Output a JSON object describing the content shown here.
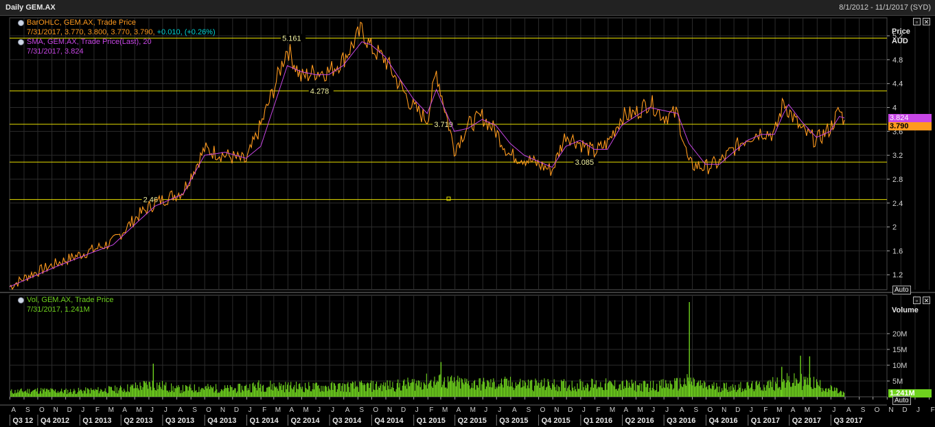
{
  "window": {
    "title": "Daily GEM.AX",
    "date_range": "8/1/2012 - 11/1/2017 (SYD)"
  },
  "price_panel": {
    "legend": {
      "ohlc_label": "BarOHLC, GEM.AX, Trade Price",
      "ohlc_values": "7/31/2017, 3.770, 3.800, 3.770, 3.790,",
      "ohlc_change": "+0.010, (+0.26%)",
      "sma_label": "SMA, GEM.AX, Trade Price(Last),  20",
      "sma_values": "7/31/2017, 3.824"
    },
    "axis_title": "Price",
    "axis_unit": "AUD",
    "auto_label": "Auto",
    "last_sma_badge": "3.824",
    "last_price_badge": "3.790"
  },
  "volume_panel": {
    "legend": {
      "label": "Vol, GEM.AX, Trade Price",
      "values": "7/31/2017, 1.241M"
    },
    "axis_title": "Volume",
    "auto_label": "Auto",
    "last_badge": "1.241M"
  },
  "colors": {
    "price": "#ff9a1e",
    "sma": "#c846e6",
    "level": "#e8e000",
    "volume": "#6fd21e",
    "change": "#00d4d4",
    "grid": "#2c2c2c"
  },
  "chart_data": [
    {
      "type": "line",
      "title": "",
      "ylabel": "Price AUD",
      "ylim": [
        0.95,
        5.5
      ],
      "grid": true,
      "y_ticks": [
        "1.2",
        "1.6",
        "2",
        "2.4",
        "2.8",
        "3.2",
        "3.6",
        "4",
        "4.4",
        "4.8",
        "5.2"
      ],
      "series": [
        {
          "name": "BarOHLC, GEM.AX, Trade Price",
          "x": [
            "2012-08-01",
            "2012-09-15",
            "2012-11-15",
            "2013-01-31",
            "2013-03-15",
            "2013-05-10",
            "2013-06-15",
            "2013-08-15",
            "2013-10-01",
            "2013-11-15",
            "2013-12-31",
            "2014-02-01",
            "2014-03-01",
            "2014-03-31",
            "2014-04-30",
            "2014-05-31",
            "2014-06-30",
            "2014-07-31",
            "2014-09-10",
            "2014-09-30",
            "2014-10-31",
            "2014-11-30",
            "2014-12-31",
            "2015-01-31",
            "2015-02-20",
            "2015-03-31",
            "2015-04-30",
            "2015-05-31",
            "2015-06-30",
            "2015-07-31",
            "2015-08-31",
            "2015-09-30",
            "2015-10-31",
            "2015-11-30",
            "2015-12-31",
            "2016-01-31",
            "2016-02-29",
            "2016-03-31",
            "2016-04-30",
            "2016-05-31",
            "2016-06-30",
            "2016-07-31",
            "2016-08-25",
            "2016-09-30",
            "2016-10-31",
            "2016-11-30",
            "2016-12-31",
            "2017-01-31",
            "2017-02-28",
            "2017-03-20",
            "2017-03-31",
            "2017-04-30",
            "2017-05-31",
            "2017-06-30",
            "2017-07-20",
            "2017-07-31"
          ],
          "values": [
            1.0,
            1.2,
            1.4,
            1.62,
            1.75,
            2.2,
            2.4,
            2.6,
            3.3,
            3.2,
            3.1,
            3.7,
            4.3,
            5.0,
            4.5,
            4.6,
            4.6,
            4.8,
            5.3,
            5.0,
            4.8,
            4.4,
            4.0,
            3.8,
            4.6,
            3.3,
            3.7,
            3.85,
            3.6,
            3.2,
            3.15,
            3.05,
            2.95,
            3.55,
            3.4,
            3.25,
            3.4,
            3.85,
            3.9,
            4.1,
            3.85,
            3.9,
            3.05,
            3.0,
            3.08,
            3.3,
            3.5,
            3.6,
            3.55,
            4.1,
            3.95,
            3.6,
            3.45,
            3.65,
            3.95,
            3.79
          ]
        },
        {
          "name": "SMA, GEM.AX, Trade Price(Last),  20",
          "x": [
            "2012-08-01",
            "2012-11-15",
            "2013-01-31",
            "2013-03-15",
            "2013-05-10",
            "2013-06-15",
            "2013-08-15",
            "2013-10-01",
            "2013-11-15",
            "2013-12-31",
            "2014-02-01",
            "2014-03-01",
            "2014-03-31",
            "2014-04-30",
            "2014-05-31",
            "2014-06-30",
            "2014-07-31",
            "2014-09-10",
            "2014-09-30",
            "2014-10-31",
            "2014-11-30",
            "2014-12-31",
            "2015-01-31",
            "2015-02-20",
            "2015-03-31",
            "2015-04-30",
            "2015-05-31",
            "2015-06-30",
            "2015-07-31",
            "2015-08-31",
            "2015-09-30",
            "2015-10-31",
            "2015-11-30",
            "2015-12-31",
            "2016-01-31",
            "2016-02-29",
            "2016-03-31",
            "2016-04-30",
            "2016-05-31",
            "2016-06-30",
            "2016-07-31",
            "2016-08-25",
            "2016-09-30",
            "2016-10-31",
            "2016-11-30",
            "2016-12-31",
            "2017-01-31",
            "2017-02-28",
            "2017-03-20",
            "2017-03-31",
            "2017-04-30",
            "2017-05-31",
            "2017-06-30",
            "2017-07-20",
            "2017-07-31"
          ],
          "values": [
            1.0,
            1.35,
            1.58,
            1.7,
            2.1,
            2.35,
            2.55,
            3.2,
            3.25,
            3.15,
            3.35,
            4.0,
            4.7,
            4.6,
            4.55,
            4.55,
            4.7,
            5.1,
            5.05,
            4.85,
            4.5,
            4.15,
            3.9,
            4.3,
            3.6,
            3.65,
            3.8,
            3.7,
            3.4,
            3.2,
            3.1,
            3.0,
            3.35,
            3.45,
            3.3,
            3.3,
            3.7,
            3.85,
            4.0,
            3.95,
            3.9,
            3.4,
            3.05,
            3.05,
            3.25,
            3.45,
            3.55,
            3.55,
            3.9,
            4.05,
            3.75,
            3.5,
            3.6,
            3.85,
            3.824
          ]
        }
      ],
      "horizontal_levels": [
        {
          "value": 5.161,
          "label": "5.161"
        },
        {
          "value": 4.278,
          "label": "4.278"
        },
        {
          "value": 3.719,
          "label": "3.719"
        },
        {
          "value": 3.085,
          "label": "3.085"
        },
        {
          "value": 2.46,
          "label": "2.46"
        }
      ]
    },
    {
      "type": "bar",
      "title": "",
      "ylabel": "Volume",
      "ylim": [
        0,
        30000000
      ],
      "y_ticks": [
        "5M",
        "10M",
        "15M",
        "20M"
      ],
      "series": [
        {
          "name": "Vol, GEM.AX, Trade Price",
          "x": [
            "2012-08-01",
            "2012-10-01",
            "2012-12-01",
            "2013-02-01",
            "2013-04-01",
            "2013-06-10",
            "2013-08-01",
            "2013-10-01",
            "2013-12-01",
            "2014-02-01",
            "2014-04-01",
            "2014-06-01",
            "2014-08-01",
            "2014-10-01",
            "2014-12-01",
            "2015-02-01",
            "2015-02-25",
            "2015-04-01",
            "2015-06-01",
            "2015-08-01",
            "2015-10-01",
            "2015-12-01",
            "2016-02-01",
            "2016-04-01",
            "2016-06-01",
            "2016-08-01",
            "2016-08-25",
            "2016-10-01",
            "2016-12-01",
            "2017-02-01",
            "2017-03-15",
            "2017-04-25",
            "2017-05-15",
            "2017-06-15",
            "2017-07-31"
          ],
          "values": [
            2000000,
            2500000,
            2200000,
            2500000,
            3000000,
            5000000,
            3000000,
            3500000,
            3000000,
            4500000,
            4000000,
            3800000,
            4000000,
            4200000,
            4500000,
            7000000,
            11000000,
            5500000,
            5000000,
            5200000,
            4800000,
            4500000,
            4800000,
            4500000,
            4200000,
            5000000,
            30000000,
            4000000,
            3800000,
            4200000,
            8000000,
            12500000,
            11500000,
            4000000,
            1241000
          ]
        }
      ],
      "volume_big_spikes": [
        {
          "x": "2016-08-25",
          "value": 30000000
        },
        {
          "x": "2017-04-25",
          "value": 13000000
        },
        {
          "x": "2017-05-15",
          "value": 12800000
        },
        {
          "x": "2015-03-01",
          "value": 11000000
        },
        {
          "x": "2013-06-10",
          "value": 10500000
        },
        {
          "x": "2017-03-15",
          "value": 9500000
        }
      ]
    }
  ],
  "time_axis": {
    "months": [
      "A",
      "S",
      "O",
      "N",
      "D",
      "J",
      "F",
      "M",
      "A",
      "M",
      "J",
      "J",
      "A",
      "S",
      "O",
      "N",
      "D",
      "J",
      "F",
      "M",
      "A",
      "M",
      "J",
      "J",
      "A",
      "S",
      "O",
      "N",
      "D",
      "J",
      "F",
      "M",
      "A",
      "M",
      "J",
      "J",
      "A",
      "S",
      "O",
      "N",
      "D",
      "J",
      "F",
      "M",
      "A",
      "M",
      "J",
      "J",
      "A",
      "S",
      "O",
      "N",
      "D",
      "J",
      "F",
      "M",
      "A",
      "M",
      "J",
      "J",
      "A",
      "S",
      "O",
      "N",
      "D",
      "J",
      "F",
      "M",
      "A",
      "M",
      "J",
      "J",
      "A",
      "S",
      "O",
      "N"
    ],
    "quarters": [
      "Q3 12",
      "Q4 2012",
      "Q1 2013",
      "Q2 2013",
      "Q3 2013",
      "Q4 2013",
      "Q1 2014",
      "Q2 2014",
      "Q3 2014",
      "Q4 2014",
      "Q1 2015",
      "Q2 2015",
      "Q3 2015",
      "Q4 2015",
      "Q1 2016",
      "Q2 2016",
      "Q3 2016",
      "Q4 2016",
      "Q1 2017",
      "Q2 2017",
      "Q3 2017"
    ]
  }
}
